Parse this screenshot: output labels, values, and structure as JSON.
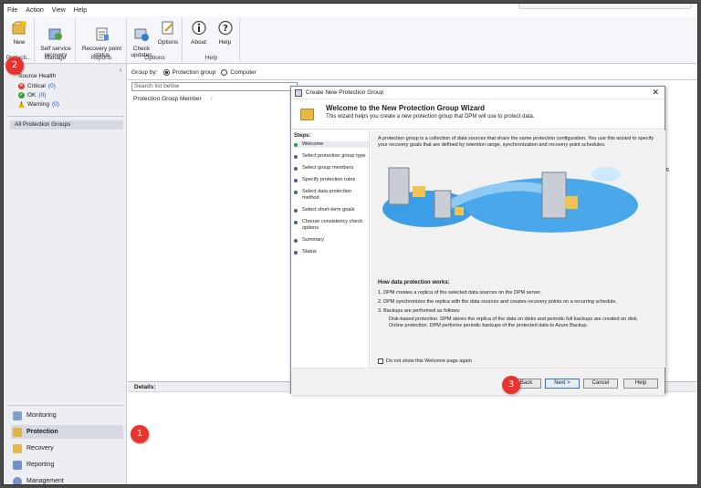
{
  "menu": [
    "File",
    "Action",
    "View",
    "Help"
  ],
  "ribbon": {
    "groups": [
      {
        "label": "Protecti...",
        "buttons": [
          {
            "label": "New"
          }
        ]
      },
      {
        "label": "Manage",
        "buttons": [
          {
            "label": "Self service\nrecovery"
          }
        ]
      },
      {
        "label": "Reports",
        "buttons": [
          {
            "label": "Recovery point\nstatus"
          }
        ]
      },
      {
        "label": "Options",
        "buttons": [
          {
            "label": "Check\nupdates"
          },
          {
            "label": "Options"
          }
        ]
      },
      {
        "label": "Help",
        "buttons": [
          {
            "label": "About"
          },
          {
            "label": "Help"
          }
        ]
      }
    ]
  },
  "source_health": {
    "title": "Source Health",
    "items": [
      {
        "label": "Critical",
        "count": "(0)",
        "color": "#d83b2d"
      },
      {
        "label": "OK",
        "count": "(0)",
        "color": "#3a9b3a"
      },
      {
        "label": "Warning",
        "count": "(0)",
        "color": "#f0b400"
      }
    ]
  },
  "left_panel": {
    "all_groups": "All Protection Groups"
  },
  "nav": [
    {
      "label": "Monitoring",
      "icon": "monitoring-icon",
      "active": false
    },
    {
      "label": "Protection",
      "icon": "protection-icon",
      "active": true
    },
    {
      "label": "Recovery",
      "icon": "recovery-icon",
      "active": false
    },
    {
      "label": "Reporting",
      "icon": "reporting-icon",
      "active": false
    },
    {
      "label": "Management",
      "icon": "management-icon",
      "active": false
    }
  ],
  "main": {
    "group_by_label": "Group by:",
    "group_by_options": [
      "Protection group",
      "Computer"
    ],
    "search_placeholder": "Search list below",
    "column_header": "Protection Group Member",
    "column_sep": "/",
    "details_label": "Details:",
    "fragment": "s"
  },
  "dialog": {
    "title": "Create New Protection Group",
    "close": "✕",
    "heading": "Welcome to the New Protection Group Wizard",
    "subheading": "This wizard helps you create a new protection group that DPM will use to protect data.",
    "steps_title": "Steps:",
    "steps": [
      "Welcome",
      "Select protection group type",
      "Select group members",
      "Specify protection rules",
      "Select data protection method",
      "Select short-term goals",
      "Choose consistency check options",
      "Summary",
      "Status"
    ],
    "intro": "A protection group is a collection of data sources that share the same protection configuration. You use this wizard to specify your recovery goals that are defined by retention range, synchronization and recovery point schedules.",
    "how_title": "How data protection works:",
    "how_items": [
      "1.  DPM creates a replica of the selected data sources on the DPM server.",
      "2.  DPM synchronizes the replica with the data sources and creates recovery points on a recurring schedule.",
      "3.  Backups are performed as follows:"
    ],
    "how_sub": [
      "Disk-based protection. DPM stores the replica of the data on disks and periodic full backups are created on disk.",
      "Online protection. DPM performs periodic backups of the protected data to Azure Backup."
    ],
    "checkbox_label": "Do not show this Welcome page again",
    "buttons": {
      "back": "< Back",
      "next": "Next >",
      "cancel": "Cancel",
      "help": "Help"
    }
  },
  "callouts": [
    "1",
    "2",
    "3"
  ],
  "colors": {
    "accent": "#1f4fd1",
    "callout": "#e8332e",
    "selected_nav": "#d5dae2"
  }
}
